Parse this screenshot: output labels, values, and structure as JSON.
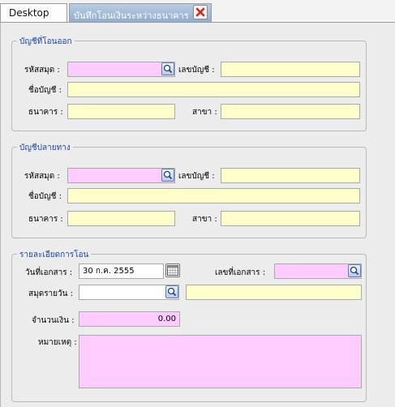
{
  "tabs": {
    "desktop": "Desktop",
    "transfer": "บันทึกโอนเงินระหว่างธนาคาร"
  },
  "source_account": {
    "title": "บัญชีที่โอนออก",
    "code_label": "รหัสสมุด :",
    "account_no_label": "เลขบัญชี :",
    "account_name_label": "ชื่อบัญชี :",
    "bank_label": "ธนาคาร :",
    "branch_label": "สาขา :",
    "code_value": "",
    "account_no_value": "",
    "account_name_value": "",
    "bank_value": "",
    "branch_value": ""
  },
  "destination_account": {
    "title": "บัญชีปลายทาง",
    "code_label": "รหัสสมุด :",
    "account_no_label": "เลขบัญชี :",
    "account_name_label": "ชื่อบัญชี :",
    "bank_label": "ธนาคาร :",
    "branch_label": "สาขา :",
    "code_value": "",
    "account_no_value": "",
    "account_name_value": "",
    "bank_value": "",
    "branch_value": ""
  },
  "transfer_details": {
    "title": "รายละเอียดการโอน",
    "doc_date_label": "วันที่เอกสาร :",
    "doc_date_value": "30 ก.ค. 2555",
    "doc_no_label": "เลขที่เอกสาร :",
    "doc_no_value": "",
    "journal_label": "สมุดรายวัน :",
    "journal_value": "",
    "journal_desc_value": "",
    "amount_label": "จำนวนเงิน :",
    "amount_value": "0.00",
    "remark_label": "หมายเหตุ :",
    "remark_value": ""
  },
  "colors": {
    "required_field": "#ffccff",
    "readonly_field": "#ffffcc",
    "group_title": "#1d44a3"
  },
  "icons": {
    "lookup": "magnifier-icon",
    "calendar": "calendar-icon",
    "close": "close-icon"
  }
}
